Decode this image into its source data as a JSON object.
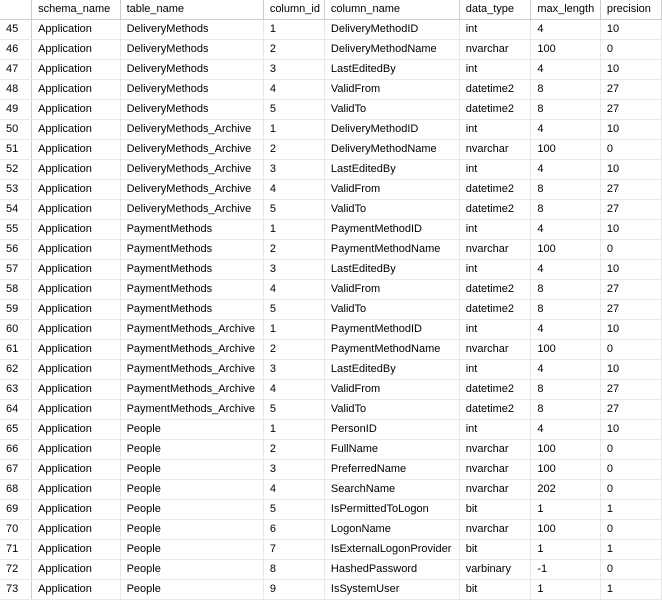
{
  "headers": {
    "schema_name": "schema_name",
    "table_name": "table_name",
    "column_id": "column_id",
    "column_name": "column_name",
    "data_type": "data_type",
    "max_length": "max_length",
    "precision": "precision"
  },
  "rows": [
    {
      "n": "45",
      "schema": "Application",
      "table": "DeliveryMethods",
      "col_id": "1",
      "col_name": "DeliveryMethodID",
      "dtype": "int",
      "mlen": "4",
      "prec": "10"
    },
    {
      "n": "46",
      "schema": "Application",
      "table": "DeliveryMethods",
      "col_id": "2",
      "col_name": "DeliveryMethodName",
      "dtype": "nvarchar",
      "mlen": "100",
      "prec": "0"
    },
    {
      "n": "47",
      "schema": "Application",
      "table": "DeliveryMethods",
      "col_id": "3",
      "col_name": "LastEditedBy",
      "dtype": "int",
      "mlen": "4",
      "prec": "10"
    },
    {
      "n": "48",
      "schema": "Application",
      "table": "DeliveryMethods",
      "col_id": "4",
      "col_name": "ValidFrom",
      "dtype": "datetime2",
      "mlen": "8",
      "prec": "27"
    },
    {
      "n": "49",
      "schema": "Application",
      "table": "DeliveryMethods",
      "col_id": "5",
      "col_name": "ValidTo",
      "dtype": "datetime2",
      "mlen": "8",
      "prec": "27"
    },
    {
      "n": "50",
      "schema": "Application",
      "table": "DeliveryMethods_Archive",
      "col_id": "1",
      "col_name": "DeliveryMethodID",
      "dtype": "int",
      "mlen": "4",
      "prec": "10"
    },
    {
      "n": "51",
      "schema": "Application",
      "table": "DeliveryMethods_Archive",
      "col_id": "2",
      "col_name": "DeliveryMethodName",
      "dtype": "nvarchar",
      "mlen": "100",
      "prec": "0"
    },
    {
      "n": "52",
      "schema": "Application",
      "table": "DeliveryMethods_Archive",
      "col_id": "3",
      "col_name": "LastEditedBy",
      "dtype": "int",
      "mlen": "4",
      "prec": "10"
    },
    {
      "n": "53",
      "schema": "Application",
      "table": "DeliveryMethods_Archive",
      "col_id": "4",
      "col_name": "ValidFrom",
      "dtype": "datetime2",
      "mlen": "8",
      "prec": "27"
    },
    {
      "n": "54",
      "schema": "Application",
      "table": "DeliveryMethods_Archive",
      "col_id": "5",
      "col_name": "ValidTo",
      "dtype": "datetime2",
      "mlen": "8",
      "prec": "27"
    },
    {
      "n": "55",
      "schema": "Application",
      "table": "PaymentMethods",
      "col_id": "1",
      "col_name": "PaymentMethodID",
      "dtype": "int",
      "mlen": "4",
      "prec": "10"
    },
    {
      "n": "56",
      "schema": "Application",
      "table": "PaymentMethods",
      "col_id": "2",
      "col_name": "PaymentMethodName",
      "dtype": "nvarchar",
      "mlen": "100",
      "prec": "0"
    },
    {
      "n": "57",
      "schema": "Application",
      "table": "PaymentMethods",
      "col_id": "3",
      "col_name": "LastEditedBy",
      "dtype": "int",
      "mlen": "4",
      "prec": "10"
    },
    {
      "n": "58",
      "schema": "Application",
      "table": "PaymentMethods",
      "col_id": "4",
      "col_name": "ValidFrom",
      "dtype": "datetime2",
      "mlen": "8",
      "prec": "27"
    },
    {
      "n": "59",
      "schema": "Application",
      "table": "PaymentMethods",
      "col_id": "5",
      "col_name": "ValidTo",
      "dtype": "datetime2",
      "mlen": "8",
      "prec": "27"
    },
    {
      "n": "60",
      "schema": "Application",
      "table": "PaymentMethods_Archive",
      "col_id": "1",
      "col_name": "PaymentMethodID",
      "dtype": "int",
      "mlen": "4",
      "prec": "10"
    },
    {
      "n": "61",
      "schema": "Application",
      "table": "PaymentMethods_Archive",
      "col_id": "2",
      "col_name": "PaymentMethodName",
      "dtype": "nvarchar",
      "mlen": "100",
      "prec": "0"
    },
    {
      "n": "62",
      "schema": "Application",
      "table": "PaymentMethods_Archive",
      "col_id": "3",
      "col_name": "LastEditedBy",
      "dtype": "int",
      "mlen": "4",
      "prec": "10"
    },
    {
      "n": "63",
      "schema": "Application",
      "table": "PaymentMethods_Archive",
      "col_id": "4",
      "col_name": "ValidFrom",
      "dtype": "datetime2",
      "mlen": "8",
      "prec": "27"
    },
    {
      "n": "64",
      "schema": "Application",
      "table": "PaymentMethods_Archive",
      "col_id": "5",
      "col_name": "ValidTo",
      "dtype": "datetime2",
      "mlen": "8",
      "prec": "27"
    },
    {
      "n": "65",
      "schema": "Application",
      "table": "People",
      "col_id": "1",
      "col_name": "PersonID",
      "dtype": "int",
      "mlen": "4",
      "prec": "10"
    },
    {
      "n": "66",
      "schema": "Application",
      "table": "People",
      "col_id": "2",
      "col_name": "FullName",
      "dtype": "nvarchar",
      "mlen": "100",
      "prec": "0"
    },
    {
      "n": "67",
      "schema": "Application",
      "table": "People",
      "col_id": "3",
      "col_name": "PreferredName",
      "dtype": "nvarchar",
      "mlen": "100",
      "prec": "0"
    },
    {
      "n": "68",
      "schema": "Application",
      "table": "People",
      "col_id": "4",
      "col_name": "SearchName",
      "dtype": "nvarchar",
      "mlen": "202",
      "prec": "0"
    },
    {
      "n": "69",
      "schema": "Application",
      "table": "People",
      "col_id": "5",
      "col_name": "IsPermittedToLogon",
      "dtype": "bit",
      "mlen": "1",
      "prec": "1"
    },
    {
      "n": "70",
      "schema": "Application",
      "table": "People",
      "col_id": "6",
      "col_name": "LogonName",
      "dtype": "nvarchar",
      "mlen": "100",
      "prec": "0"
    },
    {
      "n": "71",
      "schema": "Application",
      "table": "People",
      "col_id": "7",
      "col_name": "IsExternalLogonProvider",
      "dtype": "bit",
      "mlen": "1",
      "prec": "1"
    },
    {
      "n": "72",
      "schema": "Application",
      "table": "People",
      "col_id": "8",
      "col_name": "HashedPassword",
      "dtype": "varbinary",
      "mlen": "-1",
      "prec": "0"
    },
    {
      "n": "73",
      "schema": "Application",
      "table": "People",
      "col_id": "9",
      "col_name": "IsSystemUser",
      "dtype": "bit",
      "mlen": "1",
      "prec": "1"
    }
  ]
}
